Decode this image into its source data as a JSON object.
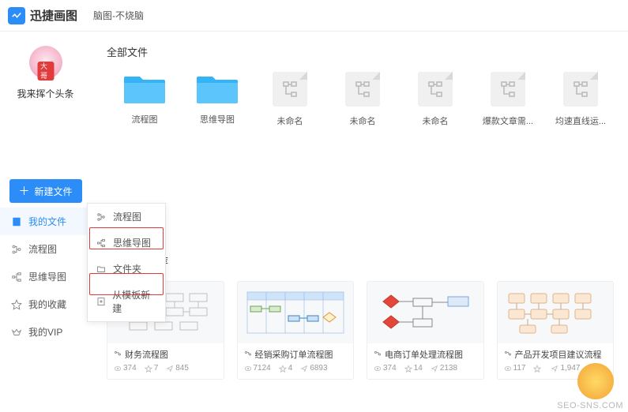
{
  "header": {
    "logo_text": "迅捷画图",
    "page_title": "脑图-不烧脑"
  },
  "user": {
    "tag": "大哥",
    "name": "我来挥个头条"
  },
  "new_button": "新建文件",
  "nav": [
    {
      "icon": "file-icon",
      "label": "我的文件",
      "active": true
    },
    {
      "icon": "flow-icon",
      "label": "流程图",
      "active": false
    },
    {
      "icon": "mind-icon",
      "label": "思维导图",
      "active": false
    },
    {
      "icon": "star-icon",
      "label": "我的收藏",
      "active": false
    },
    {
      "icon": "vip-icon",
      "label": "我的VIP",
      "active": false
    }
  ],
  "popup": [
    {
      "icon": "flow",
      "label": "流程图"
    },
    {
      "icon": "mind",
      "label": "思维导图"
    },
    {
      "icon": "folder",
      "label": "文件夹"
    },
    {
      "icon": "template",
      "label": "从模板新建"
    }
  ],
  "sections": {
    "all_files": "全部文件",
    "templates": "常用模板推荐"
  },
  "files": [
    {
      "type": "folder",
      "label": "流程图"
    },
    {
      "type": "folder",
      "label": "思维导图"
    },
    {
      "type": "doc",
      "label": "未命名"
    },
    {
      "type": "doc",
      "label": "未命名"
    },
    {
      "type": "doc",
      "label": "未命名"
    },
    {
      "type": "doc",
      "label": "爆款文章需..."
    },
    {
      "type": "doc",
      "label": "均速直线运..."
    }
  ],
  "templates": [
    {
      "name": "财务流程图",
      "views": "374",
      "likes": "7",
      "shares": "845"
    },
    {
      "name": "经销采购订单流程图",
      "views": "7124",
      "likes": "4",
      "shares": "6893"
    },
    {
      "name": "电商订单处理流程图",
      "views": "374",
      "likes": "14",
      "shares": "2138"
    },
    {
      "name": "产品开发项目建议流程",
      "views": "117",
      "likes": "",
      "shares": "1,947"
    }
  ],
  "watermark": "SEO-SNS.COM"
}
